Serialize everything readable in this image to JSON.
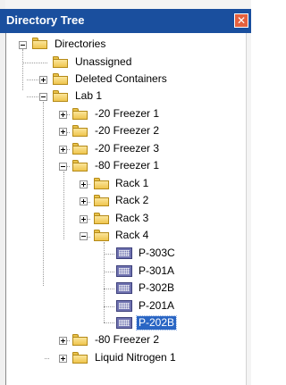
{
  "window": {
    "title": "Directory Tree",
    "close_glyph": "✕"
  },
  "tree": {
    "root": {
      "label": "Directories",
      "expanded": true
    },
    "unassigned": {
      "label": "Unassigned"
    },
    "deleted": {
      "label": "Deleted Containers",
      "expanded": false
    },
    "lab1": {
      "label": "Lab 1",
      "expanded": true
    },
    "fz20_1": {
      "label": "-20 Freezer 1",
      "expanded": false
    },
    "fz20_2": {
      "label": "-20 Freezer 2",
      "expanded": false
    },
    "fz20_3": {
      "label": "-20 Freezer 3",
      "expanded": false
    },
    "fz80_1": {
      "label": "-80 Freezer 1",
      "expanded": true
    },
    "rack1": {
      "label": "Rack 1",
      "expanded": false
    },
    "rack2": {
      "label": "Rack 2",
      "expanded": false
    },
    "rack3": {
      "label": "Rack 3",
      "expanded": false
    },
    "rack4": {
      "label": "Rack 4",
      "expanded": true
    },
    "plates": [
      {
        "label": "P-303C"
      },
      {
        "label": "P-301A"
      },
      {
        "label": "P-302B"
      },
      {
        "label": "P-201A"
      },
      {
        "label": "P-202B",
        "selected": true
      }
    ],
    "fz80_2": {
      "label": "-80 Freezer 2",
      "expanded": false
    },
    "ln1": {
      "label": "Liquid Nitrogen 1",
      "expanded": false
    }
  },
  "colors": {
    "titlebar": "#1a4f9e",
    "close_button": "#e6613e",
    "selection": "#2a66c4",
    "folder": "#efc54e",
    "plate_icon": "#6f72b0"
  },
  "icons": {
    "folder": "folder-icon",
    "plate": "plate-icon",
    "expand": "plus-box-icon",
    "collapse": "minus-box-icon",
    "close": "close-icon"
  }
}
